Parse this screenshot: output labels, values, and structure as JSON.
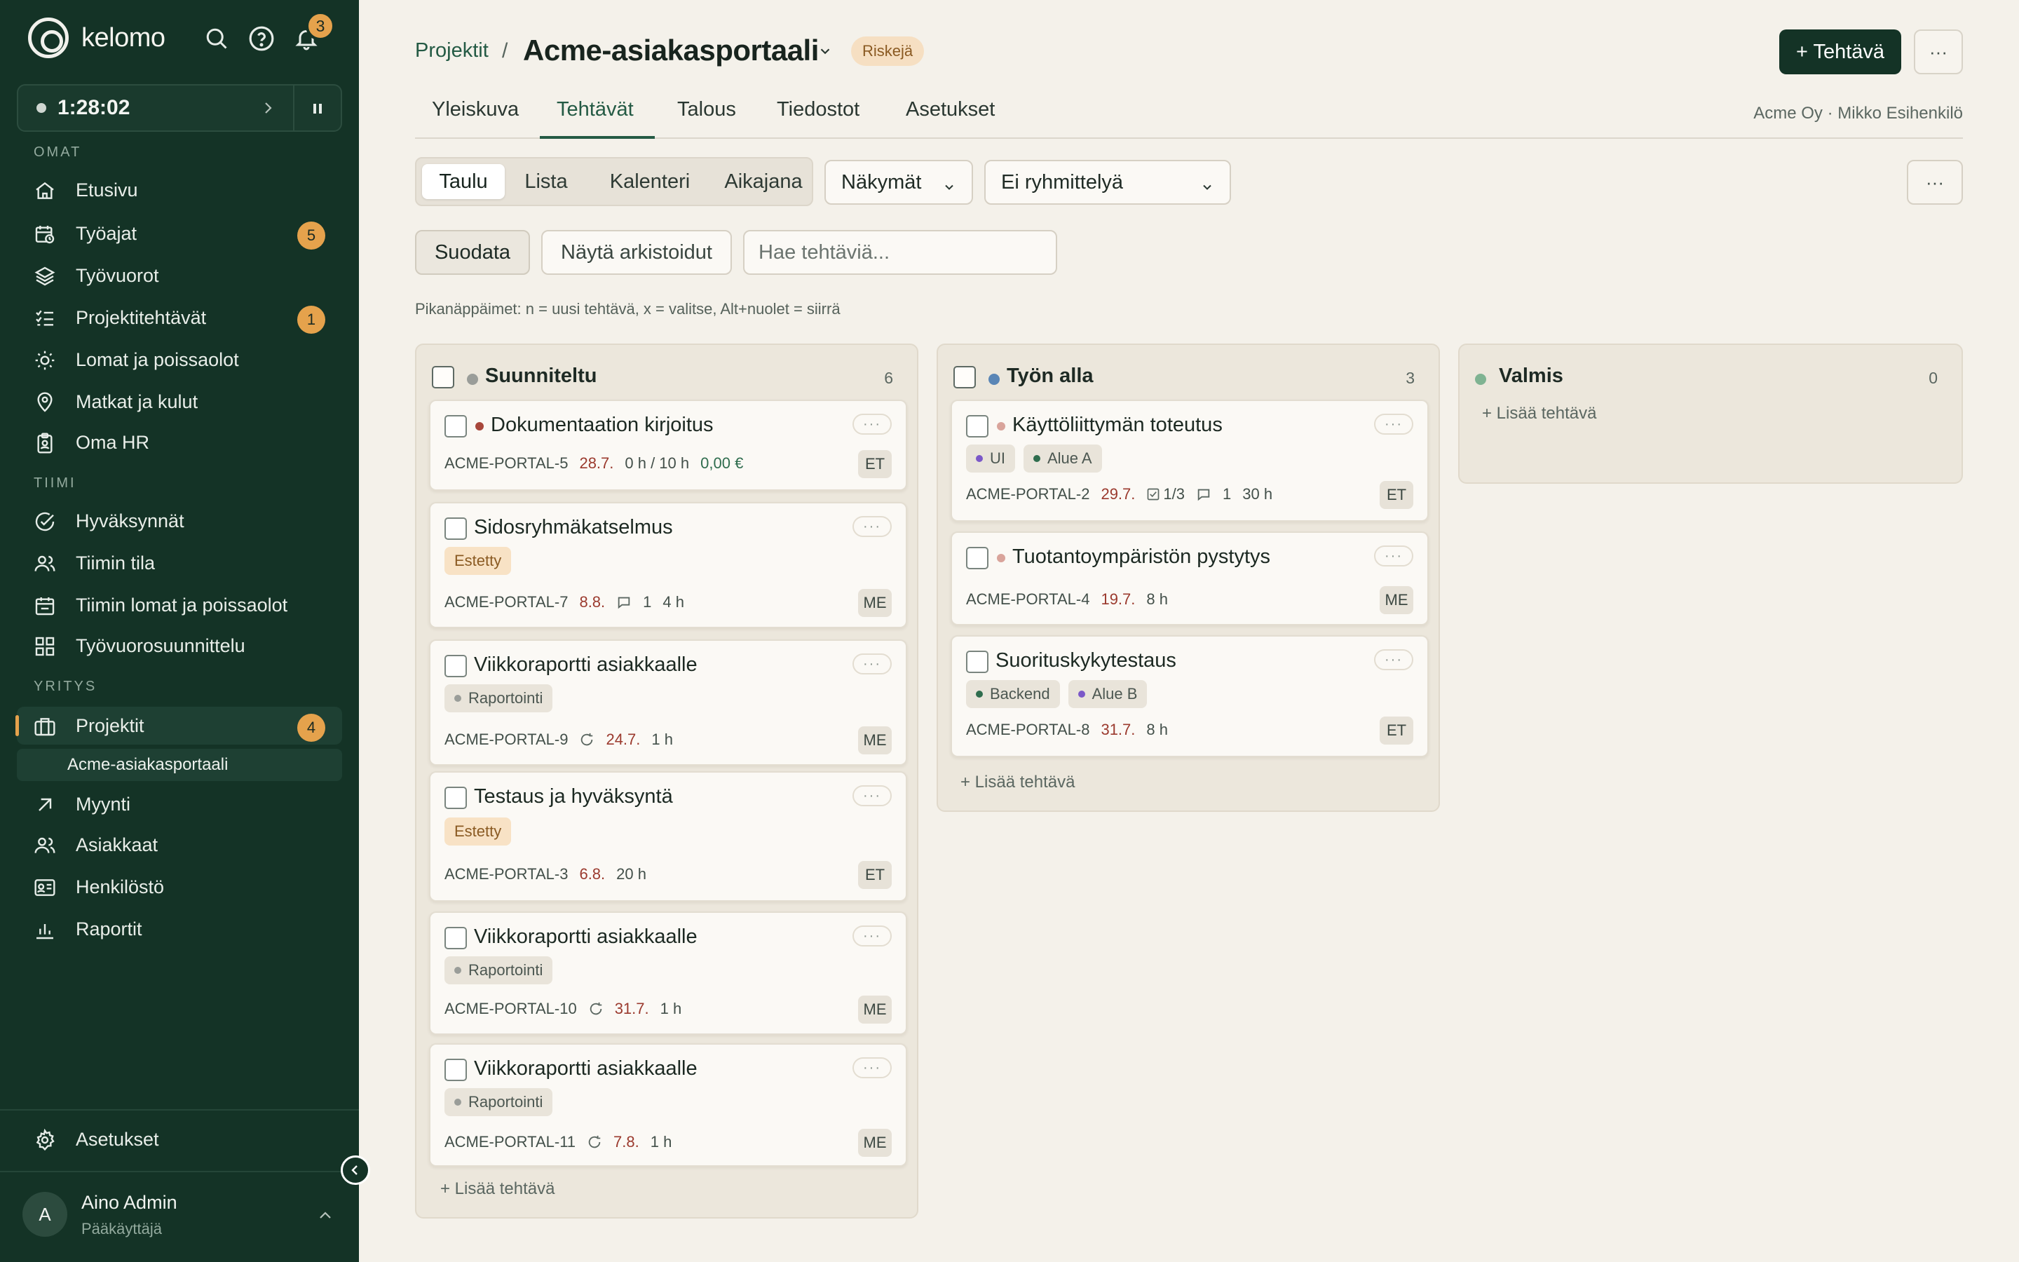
{
  "app": {
    "brand": "kelomo",
    "notification_count": "3",
    "timer": "1:28:02"
  },
  "sidebar": {
    "sections": {
      "omat": "OMAT",
      "tiimi": "TIIMI",
      "yritys": "YRITYS"
    },
    "items": [
      {
        "label": "Etusivu",
        "icon": "home-icon"
      },
      {
        "label": "Työajat",
        "icon": "calendar-clock-icon",
        "badge": "5"
      },
      {
        "label": "Työvuorot",
        "icon": "layers-icon"
      },
      {
        "label": "Projektitehtävät",
        "icon": "checklist-icon",
        "badge": "1"
      },
      {
        "label": "Lomat ja poissaolot",
        "icon": "sun-icon"
      },
      {
        "label": "Matkat ja kulut",
        "icon": "map-pin-icon"
      },
      {
        "label": "Oma HR",
        "icon": "badge-icon"
      },
      {
        "label": "Hyväksynnät",
        "icon": "check-circle-icon"
      },
      {
        "label": "Tiimin tila",
        "icon": "users-icon"
      },
      {
        "label": "Tiimin lomat ja poissaolot",
        "icon": "calendar-icon"
      },
      {
        "label": "Työvuorosuunnittelu",
        "icon": "grid-icon"
      },
      {
        "label": "Projektit",
        "icon": "briefcase-icon",
        "badge": "4"
      },
      {
        "label": "Myynti",
        "icon": "arrow-up-right-icon"
      },
      {
        "label": "Asiakkaat",
        "icon": "users-icon"
      },
      {
        "label": "Henkilöstö",
        "icon": "id-card-icon"
      },
      {
        "label": "Raportit",
        "icon": "bar-chart-icon"
      }
    ],
    "sub_item": "Acme-asiakasportaali",
    "settings": "Asetukset",
    "user": {
      "initial": "A",
      "name": "Aino Admin",
      "role": "Pääkäyttäjä"
    }
  },
  "header": {
    "breadcrumb_link": "Projektit",
    "breadcrumb_sep": "/",
    "title": "Acme-asiakasportaali",
    "status_badge": "Riskejä",
    "new_task": "+ Tehtävä",
    "more": "···"
  },
  "tabs": [
    "Yleiskuva",
    "Tehtävät",
    "Talous",
    "Tiedostot",
    "Asetukset"
  ],
  "client": "Acme Oy · Mikko Esihenkilö",
  "views": [
    "Taulu",
    "Lista",
    "Kalenteri",
    "Aikajana"
  ],
  "views_dropdown": "Näkymät",
  "grouping_dropdown": "Ei ryhmittelyä",
  "toolbar": {
    "filter": "Suodata",
    "show_archived": "Näytä arkistoidut",
    "search_placeholder": "Hae tehtäviä...",
    "hint": "Pikanäppäimet: n = uusi tehtävä, x = valitse, Alt+nuolet = siirrä",
    "add_task": "+ Lisää tehtävä"
  },
  "colors": {
    "accent": "#245a44",
    "badge": "#e5a24c",
    "planned": "#9a9d99",
    "in_progress": "#5a86b6",
    "done": "#7fb392"
  },
  "columns": [
    {
      "title": "Suunniteltu",
      "count": "6",
      "cards": [
        {
          "title": "Dokumentaation kirjoitus",
          "id": "ACME-PORTAL-5",
          "due": "28.7.",
          "hours": "0 h / 10 h",
          "money": "0,00 €",
          "assignee": "ET"
        },
        {
          "title": "Sidosryhmäkatselmus",
          "tag": "Estetty",
          "id": "ACME-PORTAL-7",
          "due": "8.8.",
          "comments": "1",
          "hours": "4 h",
          "assignee": "ME"
        },
        {
          "title": "Viikkoraportti asiakkaalle",
          "tag": "Raportointi",
          "id": "ACME-PORTAL-9",
          "due": "24.7.",
          "hours": "1 h",
          "assignee": "ME"
        },
        {
          "title": "Testaus ja hyväksyntä",
          "tag": "Estetty",
          "id": "ACME-PORTAL-3",
          "due": "6.8.",
          "hours": "20 h",
          "assignee": "ET"
        },
        {
          "title": "Viikkoraportti asiakkaalle",
          "tag": "Raportointi",
          "id": "ACME-PORTAL-10",
          "due": "31.7.",
          "hours": "1 h",
          "assignee": "ME"
        },
        {
          "title": "Viikkoraportti asiakkaalle",
          "tag": "Raportointi",
          "id": "ACME-PORTAL-11",
          "due": "7.8.",
          "hours": "1 h",
          "assignee": "ME"
        }
      ]
    },
    {
      "title": "Työn alla",
      "count": "3",
      "cards": [
        {
          "title": "Käyttöliittymän toteutus",
          "tags": [
            "UI",
            "Alue A"
          ],
          "id": "ACME-PORTAL-2",
          "due": "29.7.",
          "checklist": "1/3",
          "comments": "1",
          "hours": "30 h",
          "assignee": "ET"
        },
        {
          "title": "Tuotantoympäristön pystytys",
          "id": "ACME-PORTAL-4",
          "due": "19.7.",
          "hours": "8 h",
          "assignee": "ME"
        },
        {
          "title": "Suorituskykytestaus",
          "tags": [
            "Backend",
            "Alue B"
          ],
          "id": "ACME-PORTAL-8",
          "due": "31.7.",
          "hours": "8 h",
          "assignee": "ET"
        }
      ]
    },
    {
      "title": "Valmis",
      "count": "0",
      "cards": []
    }
  ]
}
